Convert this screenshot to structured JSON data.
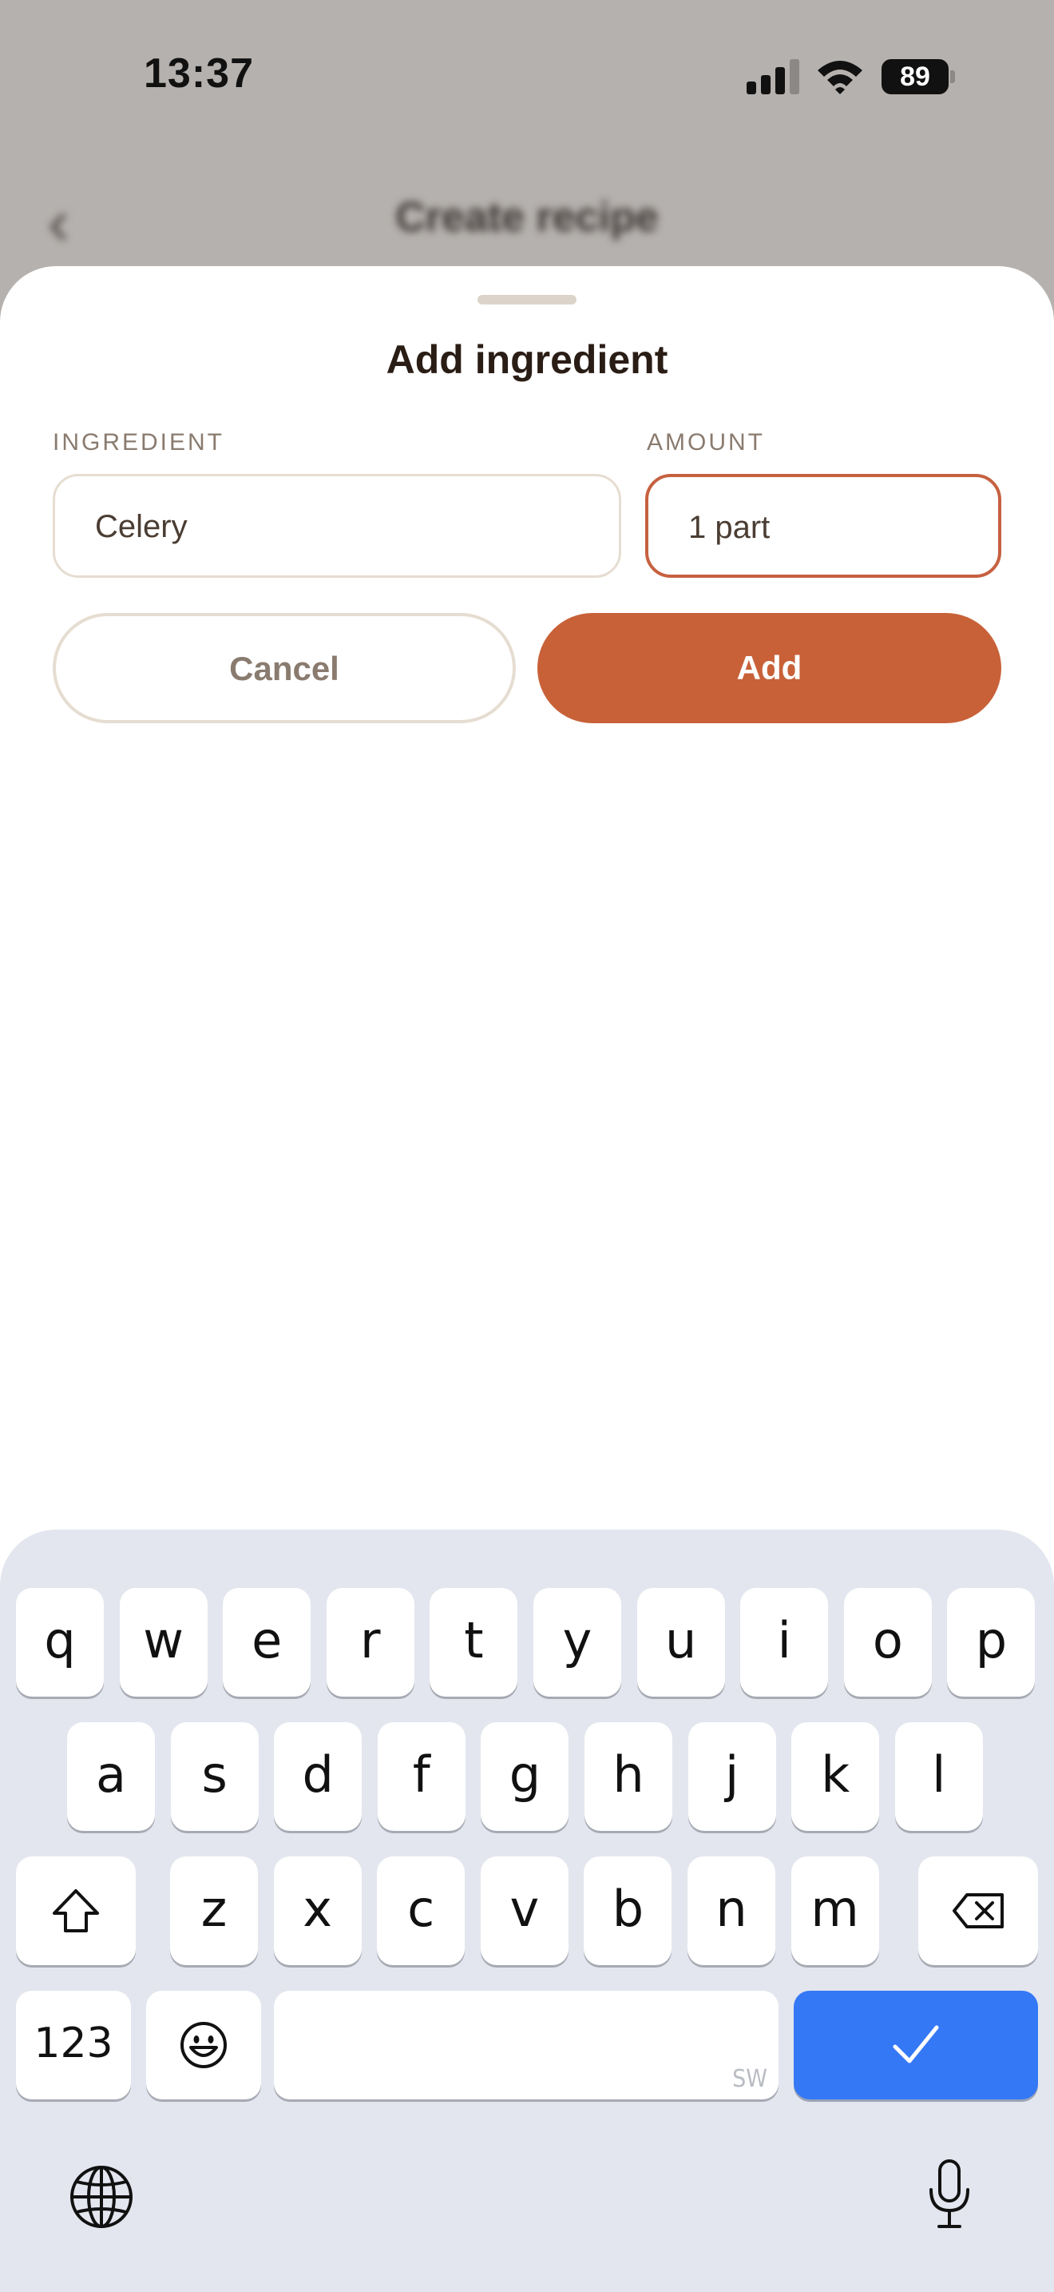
{
  "status_bar": {
    "time": "13:37",
    "battery": "89"
  },
  "background": {
    "title": "Create recipe",
    "back_icon": "chevron-left-icon"
  },
  "sheet": {
    "title": "Add ingredient",
    "ingredient_label": "INGREDIENT",
    "ingredient_value": "Celery",
    "amount_label": "AMOUNT",
    "amount_value": "1 part",
    "cancel_label": "Cancel",
    "add_label": "Add"
  },
  "colors": {
    "accent": "#c86138",
    "border": "#e6ddd2",
    "keyboard_bg": "#e3e6ee",
    "done_key": "#3578f6"
  },
  "keyboard": {
    "row1": [
      "q",
      "w",
      "e",
      "r",
      "t",
      "y",
      "u",
      "i",
      "o",
      "p"
    ],
    "row2": [
      "a",
      "s",
      "d",
      "f",
      "g",
      "h",
      "j",
      "k",
      "l"
    ],
    "row3": [
      "z",
      "x",
      "c",
      "v",
      "b",
      "n",
      "m"
    ],
    "numbers_label": "123",
    "space_hint": "SW",
    "icons": [
      "shift-icon",
      "backspace-icon",
      "emoji-icon",
      "checkmark-icon",
      "globe-icon",
      "microphone-icon"
    ]
  }
}
